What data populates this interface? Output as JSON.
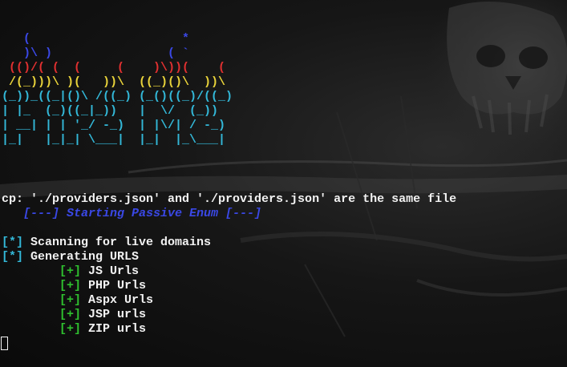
{
  "banner": {
    "lines": [
      {
        "text": "   (                     *",
        "color": "#3a48e6"
      },
      {
        "text": "   )\\ )                ( `",
        "color": "#3a48e6"
      },
      {
        "text": " (()/( (  (     (    )\\))(    (",
        "color": "#e03030"
      },
      {
        "text": " /(_)))\\ )(   ))\\  ((_)()\\  ))\\",
        "color": "#e8d23a"
      },
      {
        "text": "(_))_((_|()\\ /((_) (_()((_)/((_)",
        "color": "#33b8d8"
      },
      {
        "text": "| |_  (_)((_|_))   |  \\/  (_))",
        "color": "#33b8d8"
      },
      {
        "text": "| __| | | '_/ -_)  | |\\/| / -_)",
        "color": "#33b8d8"
      },
      {
        "text": "|_|   |_|_| \\___|  |_|  |_\\___|",
        "color": "#33b8d8"
      }
    ]
  },
  "output": {
    "cp_error": "cp: './providers.json' and './providers.json' are the same file",
    "section_header": "   [---] Starting Passive Enum [---]",
    "steps": [
      {
        "marker": "[*]",
        "text": " Scanning for live domains"
      },
      {
        "marker": "[*]",
        "text": " Generating URLS"
      }
    ],
    "substeps": [
      {
        "marker": "        [+]",
        "text": " JS Urls"
      },
      {
        "marker": "        [+]",
        "text": " PHP Urls"
      },
      {
        "marker": "        [+]",
        "text": " Aspx Urls"
      },
      {
        "marker": "        [+]",
        "text": " JSP urls"
      },
      {
        "marker": "        [+]",
        "text": " ZIP urls"
      }
    ]
  },
  "colors": {
    "banner_blue": "#3a48e6",
    "banner_red": "#e03030",
    "banner_yellow": "#e8d23a",
    "banner_cyan": "#33b8d8",
    "text": "#f2f2f2",
    "marker_cyan": "#33b8d8",
    "marker_green": "#2fc02f",
    "header_blue": "#3a48e6"
  }
}
